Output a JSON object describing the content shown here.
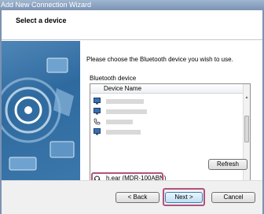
{
  "window": {
    "title": "Add New Connection Wizard"
  },
  "header": {
    "title": "Select a device"
  },
  "content": {
    "instruction": "Please choose the Bluetooth device you wish to use.",
    "group_label": "Bluetooth device",
    "list": {
      "column_header": "Device Name",
      "items": [
        {
          "icon": "monitor-icon",
          "label": ""
        },
        {
          "icon": "monitor-icon",
          "label": ""
        },
        {
          "icon": "phone-icon",
          "label": ""
        },
        {
          "icon": "monitor-icon",
          "label": ""
        },
        {
          "icon": "headset-icon",
          "label": "h.ear (MDR-100ABN)"
        },
        {
          "icon": "monitor-icon",
          "label": ""
        }
      ]
    },
    "refresh_label": "Refresh"
  },
  "footer": {
    "back_label": "< Back",
    "next_label": "Next >",
    "cancel_label": "Cancel"
  }
}
